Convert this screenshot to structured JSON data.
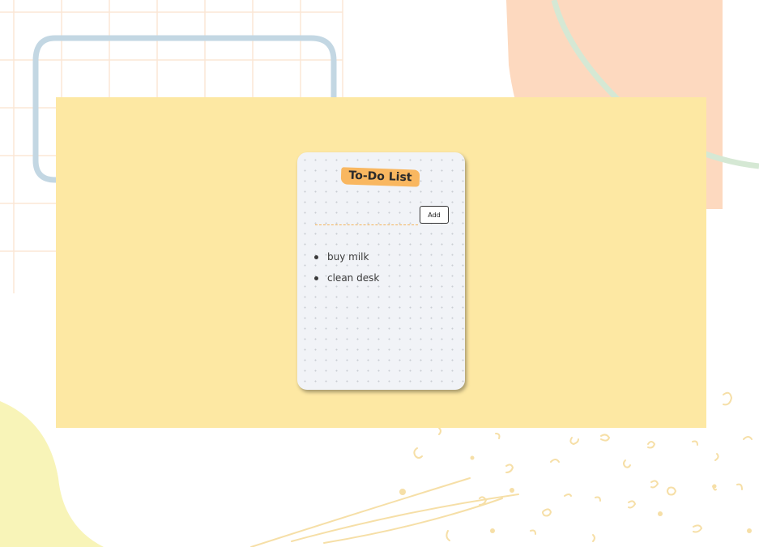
{
  "app": {
    "title": "To-Do List",
    "input": {
      "value": "",
      "placeholder": ""
    },
    "add_label": "Add",
    "items": [
      {
        "text": "buy milk"
      },
      {
        "text": "clean desk"
      }
    ]
  },
  "colors": {
    "panel": "#fde8a3",
    "card": "#f1f3f7",
    "title_highlight": "#f9b760",
    "input_underline": "#f4b55b",
    "peach_blob": "#fdd9bf",
    "mint_ring": "#d5e8d4",
    "blue_frame": "#c3d7e3",
    "yellow_blob": "#f8f4b8",
    "grid_lines": "#fbe7d6",
    "doodles": "#f6dfa7"
  }
}
